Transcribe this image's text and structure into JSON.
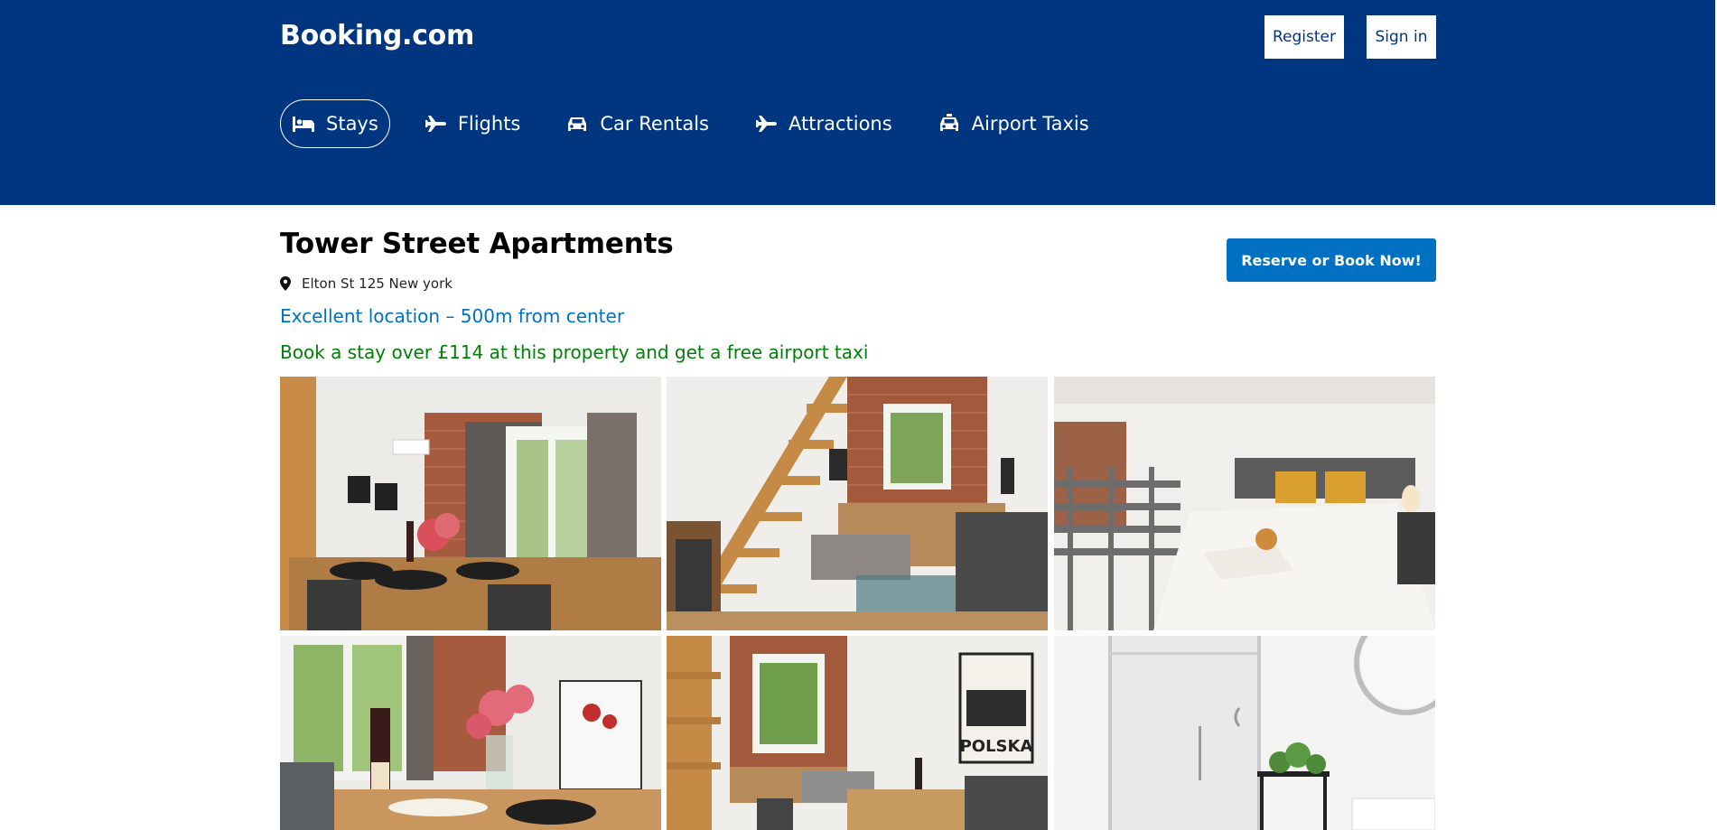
{
  "header": {
    "logo": "Booking.com",
    "register_label": "Register",
    "signin_label": "Sign in",
    "background_color": "#003580"
  },
  "nav": {
    "items": [
      {
        "label": "Stays",
        "icon": "bed-icon",
        "active": true
      },
      {
        "label": "Flights",
        "icon": "plane-icon",
        "active": false
      },
      {
        "label": "Car Rentals",
        "icon": "car-icon",
        "active": false
      },
      {
        "label": "Attractions",
        "icon": "plane-icon",
        "active": false
      },
      {
        "label": "Airport Taxis",
        "icon": "taxi-icon",
        "active": false
      }
    ]
  },
  "hotel": {
    "name": "Tower Street Apartments",
    "address": "Elton St 125 New york",
    "location_note": "Excellent location – 500m from center",
    "promo": "Book a stay over £114 at this property and get a free airport taxi",
    "reserve_label": "Reserve or Book Now!",
    "location_color": "#0071c2",
    "promo_color": "#008009",
    "button_color": "#0071c2"
  },
  "gallery": {
    "photos": [
      {
        "subject": "dining-room-photo"
      },
      {
        "subject": "living-room-staircase-photo"
      },
      {
        "subject": "bedroom-photo"
      },
      {
        "subject": "dining-table-flowers-photo"
      },
      {
        "subject": "living-room-poster-photo",
        "poster_text": "POLSKA"
      },
      {
        "subject": "bathroom-photo"
      }
    ]
  }
}
